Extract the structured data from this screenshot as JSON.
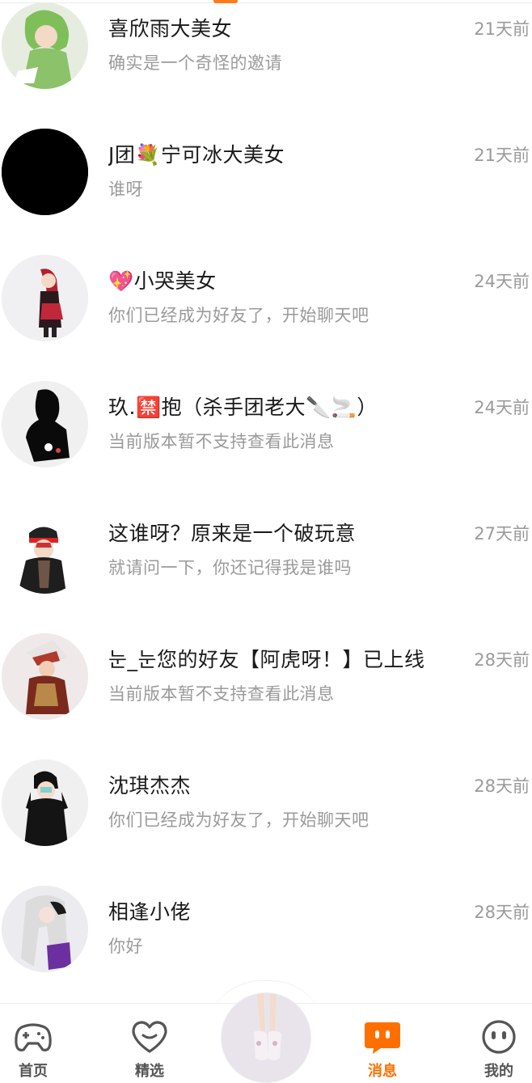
{
  "conversations": [
    {
      "name": "喜欣雨大美女",
      "preview": "确实是一个奇怪的邀请",
      "time": "21天前",
      "avatar": "green-hair-anime-girl-avatar"
    },
    {
      "name": "J团💐宁可冰大美女",
      "preview": "谁呀",
      "time": "21天前",
      "avatar": "black-avatar"
    },
    {
      "name": "💖小哭美女",
      "preview": "你们已经成为好友了，开始聊天吧",
      "time": "24天前",
      "avatar": "red-hair-girl-avatar"
    },
    {
      "name": "玖.🈲抱（杀手团老大🔪🚬）",
      "preview": "当前版本暂不支持查看此消息",
      "time": "24天前",
      "avatar": "silhouette-avatar"
    },
    {
      "name": "这谁呀？原来是一个破玩意",
      "preview": "就请问一下，你还记得我是谁吗",
      "time": "27天前",
      "avatar": "cap-boy-avatar"
    },
    {
      "name": "눈_눈您的好友【阿虎呀！】已上线",
      "preview": "当前版本暂不支持查看此消息",
      "time": "28天前",
      "avatar": "armored-character-avatar"
    },
    {
      "name": "沈琪杰杰",
      "preview": "你们已经成为好友了，开始聊天吧",
      "time": "28天前",
      "avatar": "black-hoodie-boy-avatar"
    },
    {
      "name": "相逢小佬",
      "preview": "你好",
      "time": "28天前",
      "avatar": "white-hair-girl-avatar"
    }
  ],
  "tabbar": {
    "home": {
      "label": "首页",
      "icon": "gamepad-icon"
    },
    "featured": {
      "label": "精选",
      "icon": "heart-icon"
    },
    "center": {
      "icon": "avatar-legs-icon"
    },
    "messages": {
      "label": "消息",
      "icon": "chat-bubble-icon"
    },
    "me": {
      "label": "我的",
      "icon": "face-icon"
    }
  },
  "colors": {
    "accent": "#ff6f00",
    "text": "#1a1a1a",
    "muted": "#9a9a9a"
  }
}
